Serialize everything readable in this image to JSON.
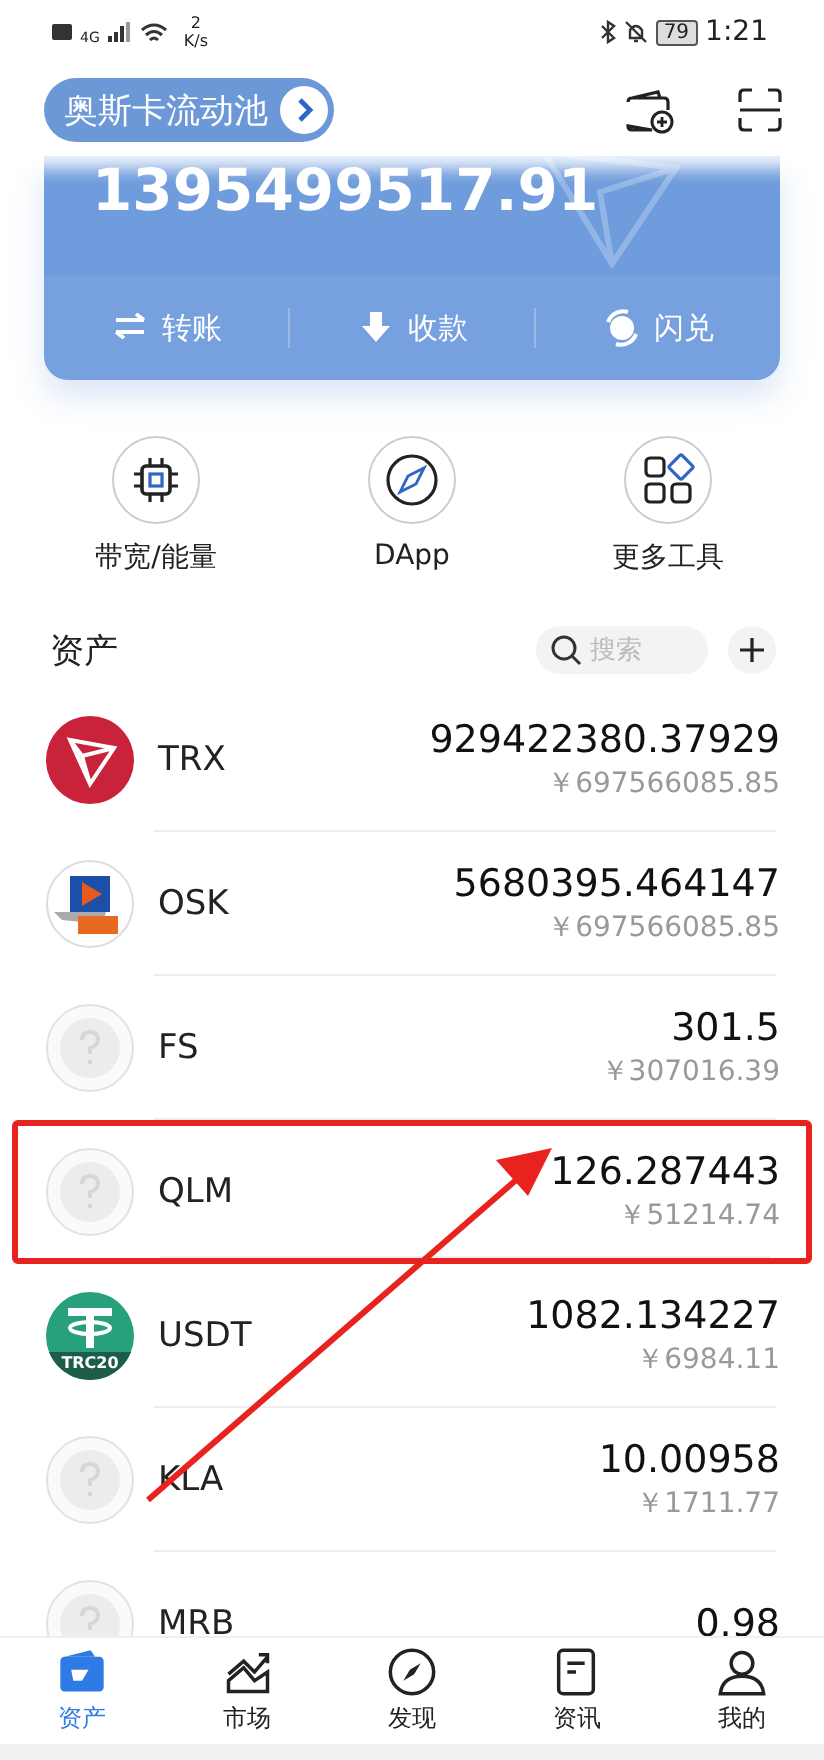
{
  "status_bar": {
    "network": "4G",
    "speed_value": "2",
    "speed_unit": "K/s",
    "battery": "79",
    "time": "1:21"
  },
  "header": {
    "pool_label": "奥斯卡流动池"
  },
  "balance_card": {
    "balance": "1395499517.91",
    "actions": [
      {
        "label": "转账",
        "kind": "transfer"
      },
      {
        "label": "收款",
        "kind": "receive"
      },
      {
        "label": "闪兑",
        "kind": "swap"
      }
    ]
  },
  "tools": [
    {
      "label": "带宽/能量",
      "kind": "chip"
    },
    {
      "label": "DApp",
      "kind": "compass"
    },
    {
      "label": "更多工具",
      "kind": "grid"
    }
  ],
  "assets": {
    "title": "资产",
    "search_placeholder": "搜索",
    "items": [
      {
        "name": "TRX",
        "kind": "trx",
        "amount": "929422380.37929",
        "fiat": "￥697566085.85",
        "highlighted": false
      },
      {
        "name": "OSK",
        "kind": "osk",
        "amount": "5680395.464147",
        "fiat": "￥697566085.85",
        "highlighted": false
      },
      {
        "name": "FS",
        "kind": "unknown",
        "amount": "301.5",
        "fiat": "￥307016.39",
        "highlighted": false
      },
      {
        "name": "QLM",
        "kind": "unknown",
        "amount": "126.287443",
        "fiat": "￥51214.74",
        "highlighted": true
      },
      {
        "name": "USDT",
        "kind": "usdt",
        "badge": "TRC20",
        "amount": "1082.134227",
        "fiat": "￥6984.11",
        "highlighted": false
      },
      {
        "name": "KLA",
        "kind": "unknown",
        "amount": "10.00958",
        "fiat": "￥1711.77",
        "highlighted": false
      },
      {
        "name": "MRB",
        "kind": "unknown",
        "amount": "0.98",
        "highlighted": false
      }
    ]
  },
  "bottom_nav": [
    {
      "label": "资产",
      "kind": "wallet",
      "selected": true
    },
    {
      "label": "市场",
      "kind": "market",
      "selected": false
    },
    {
      "label": "发现",
      "kind": "compass",
      "selected": false
    },
    {
      "label": "资讯",
      "kind": "news",
      "selected": false
    },
    {
      "label": "我的",
      "kind": "person",
      "selected": false
    }
  ]
}
